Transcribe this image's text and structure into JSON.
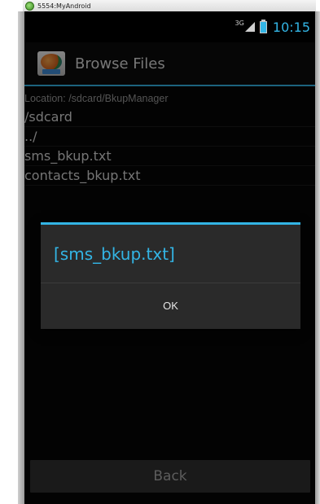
{
  "emulator": {
    "title": "5554:MyAndroid"
  },
  "status_bar": {
    "network_type": "3G",
    "time": "10:15"
  },
  "action_bar": {
    "title": "Browse Files"
  },
  "location": "Location: /sdcard/BkupManager",
  "file_list": [
    "/sdcard",
    "../",
    "sms_bkup.txt",
    "contacts_bkup.txt"
  ],
  "dialog": {
    "title": "[sms_bkup.txt]",
    "ok_label": "OK"
  },
  "back_button": {
    "label": "Back"
  },
  "colors": {
    "accent": "#33b5e5"
  },
  "icons": [
    "emulator-app-icon",
    "signal-icon",
    "battery-icon",
    "app-icon"
  ]
}
